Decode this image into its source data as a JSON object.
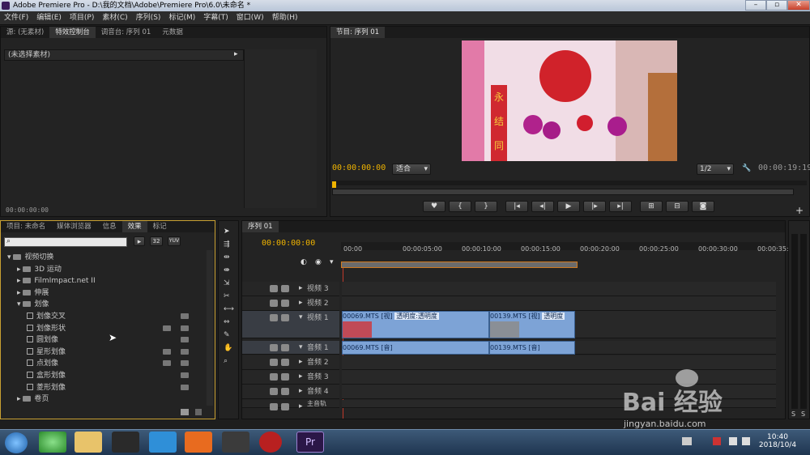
{
  "window": {
    "title": "Adobe Premiere Pro - D:\\我的文档\\Adobe\\Premiere Pro\\6.0\\未命名 *"
  },
  "menu": [
    "文件(F)",
    "编辑(E)",
    "项目(P)",
    "素材(C)",
    "序列(S)",
    "标记(M)",
    "字幕(T)",
    "窗口(W)",
    "帮助(H)"
  ],
  "source_panel": {
    "tabs": [
      "源: (无素材)",
      "特效控制台",
      "调音台: 序列 01",
      "元数据"
    ],
    "no_clip": "(未选择素材)",
    "timecode": "00:00:00:00"
  },
  "program_panel": {
    "tab": "节目: 序列 01",
    "timecode": "00:00:00:00",
    "fit": "适合",
    "resolution": "1/2",
    "duration": "00:00:19:19"
  },
  "video_frame": {
    "banner_chars": [
      "永",
      "结",
      "同"
    ]
  },
  "project_panel": {
    "tabs": [
      "项目: 未命名",
      "媒体浏览器",
      "信息",
      "效果",
      "标记"
    ],
    "badges": [
      "32",
      "YUV"
    ],
    "tree": [
      {
        "label": "视频切换",
        "level": 0,
        "type": "folder",
        "open": true
      },
      {
        "label": "3D 运动",
        "level": 1,
        "type": "folder",
        "open": false
      },
      {
        "label": "FilmImpact.net II",
        "level": 1,
        "type": "folder",
        "open": false
      },
      {
        "label": "伸展",
        "level": 1,
        "type": "folder",
        "open": false
      },
      {
        "label": "划像",
        "level": 1,
        "type": "folder",
        "open": true
      },
      {
        "label": "划像交叉",
        "level": 2,
        "type": "effect"
      },
      {
        "label": "划像形状",
        "level": 2,
        "type": "effect"
      },
      {
        "label": "圆划像",
        "level": 2,
        "type": "effect"
      },
      {
        "label": "星形划像",
        "level": 2,
        "type": "effect"
      },
      {
        "label": "点划像",
        "level": 2,
        "type": "effect"
      },
      {
        "label": "盒形划像",
        "level": 2,
        "type": "effect"
      },
      {
        "label": "菱形划像",
        "level": 2,
        "type": "effect"
      },
      {
        "label": "卷页",
        "level": 1,
        "type": "folder",
        "open": false
      }
    ]
  },
  "timeline": {
    "tab": "序列 01",
    "timecode": "00:00:00:00",
    "ruler": [
      "00:00",
      "00:00:05:00",
      "00:00:10:00",
      "00:00:15:00",
      "00:00:20:00",
      "00:00:25:00",
      "00:00:30:00",
      "00:00:35:00"
    ],
    "tracks": [
      "视频 3",
      "视频 2",
      "视频 1",
      "音频 1",
      "音频 2",
      "音频 3",
      "音频 4",
      "主音轨"
    ],
    "video_clips": [
      {
        "name": "00069.MTS [视]",
        "fx": "透明度:透明度"
      },
      {
        "name": "00139.MTS [视]",
        "fx": "透明度"
      }
    ],
    "audio_clips": [
      {
        "name": "00069.MTS [音]"
      },
      {
        "name": "00139.MTS [音]"
      }
    ]
  },
  "taskbar": {
    "time": "10:40",
    "date": "2018/10/4"
  },
  "watermark": {
    "brand": "Bai 经验",
    "url": "jingyan.baidu.com"
  }
}
